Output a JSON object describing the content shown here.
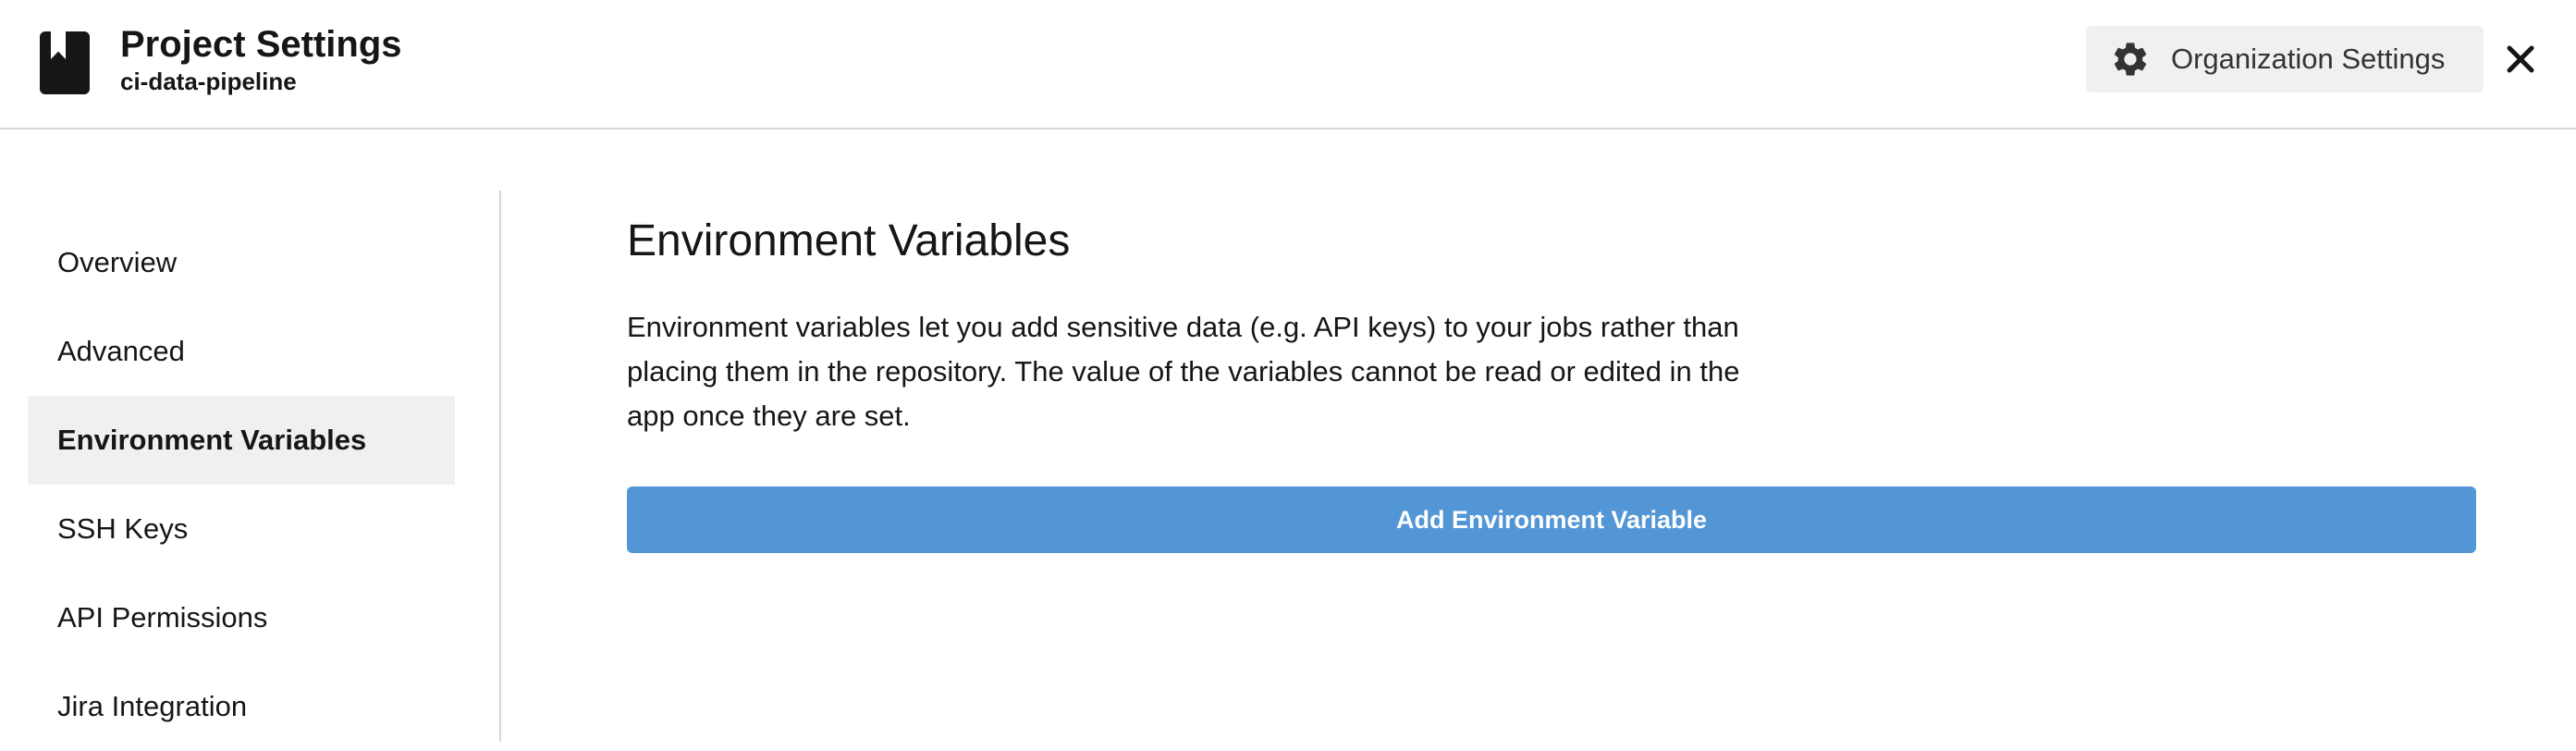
{
  "header": {
    "title": "Project Settings",
    "subtitle": "ci-data-pipeline",
    "project_icon": "bookmark-book-icon",
    "org_settings_label": "Organization Settings",
    "org_settings_icon": "gear-icon",
    "close_icon": "close-icon"
  },
  "sidebar": {
    "items": [
      {
        "label": "Overview",
        "active": false
      },
      {
        "label": "Advanced",
        "active": false
      },
      {
        "label": "Environment Variables",
        "active": true
      },
      {
        "label": "SSH Keys",
        "active": false
      },
      {
        "label": "API Permissions",
        "active": false
      },
      {
        "label": "Jira Integration",
        "active": false
      }
    ]
  },
  "main": {
    "title": "Environment Variables",
    "description": "Environment variables let you add sensitive data (e.g. API keys) to your jobs rather than placing them in the repository. The value of the variables cannot be read or edited in the app once they are set.",
    "add_button_label": "Add Environment Variable"
  },
  "colors": {
    "accent_button": "#5296d5",
    "active_nav_bg": "#f0f0f0",
    "text": "#161616"
  }
}
